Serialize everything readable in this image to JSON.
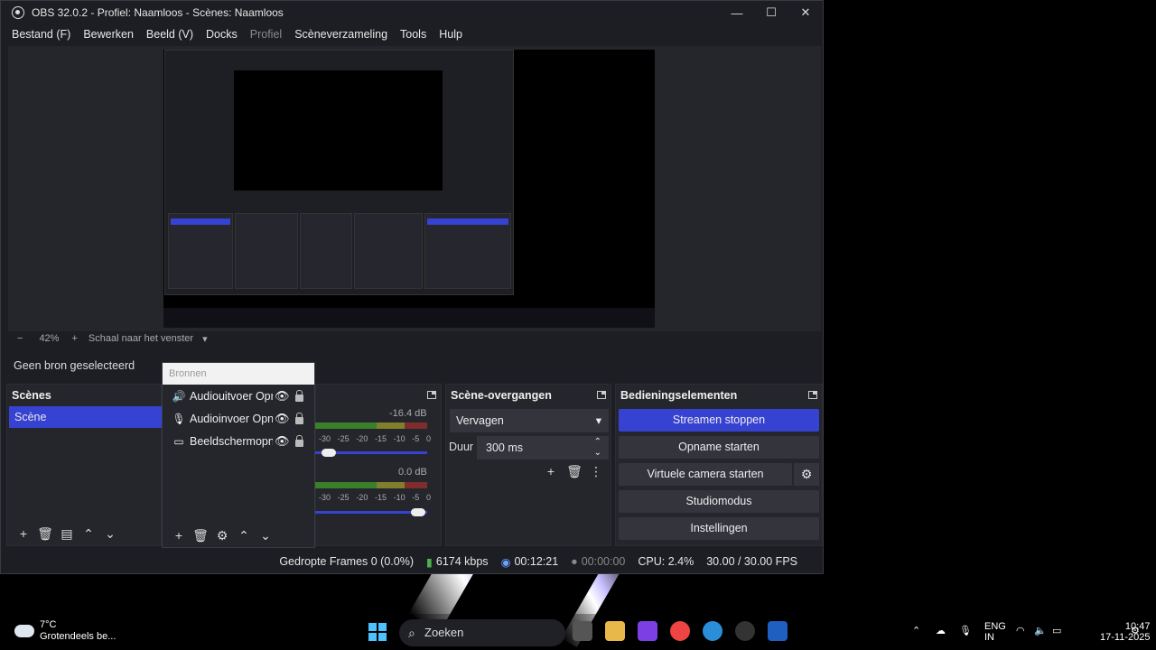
{
  "window": {
    "title": "OBS 32.0.2 - Profiel: Naamloos - Scènes: Naamloos",
    "minimize": "—",
    "maximize": "☐",
    "close": "✕"
  },
  "menu": [
    "Bestand (F)",
    "Bewerken",
    "Beeld (V)",
    "Docks",
    "Profiel",
    "Scèneverzameling",
    "Tools",
    "Hulp"
  ],
  "zoom": {
    "minus": "−",
    "level": "42%",
    "plus": "+",
    "mode": "Schaal naar het venster"
  },
  "source_toolbar": {
    "no_source": "Geen bron geselecteerd"
  },
  "scenes": {
    "title": "Scènes",
    "items": [
      "Scène"
    ]
  },
  "sources": {
    "header": "Bronnen",
    "items": [
      {
        "name": "Audiouitvoer Opname",
        "icon": "speaker-icon"
      },
      {
        "name": "Audioinvoer Opname",
        "icon": "microphone-icon"
      },
      {
        "name": "Beeldschermopname",
        "icon": "monitor-icon"
      }
    ]
  },
  "mixer": {
    "tracks": [
      {
        "db": "-16.4 dB",
        "volume": 0.12
      },
      {
        "db": "0.0 dB",
        "volume": 0.92
      }
    ],
    "scale": [
      "-30",
      "-25",
      "-20",
      "-15",
      "-10",
      "-5",
      "0"
    ]
  },
  "transitions": {
    "title": "Scène-overgangen",
    "type": "Vervagen",
    "duration_label": "Duur",
    "duration": "300 ms"
  },
  "controls": {
    "title": "Bedieningselementen",
    "buttons": [
      "Streamen stoppen",
      "Opname starten",
      "Virtuele camera starten",
      "Studiomodus",
      "Instellingen"
    ]
  },
  "status": {
    "dropped": "Gedropte Frames 0 (0.0%)",
    "bitrate": "6174 kbps",
    "stream_time": "00:12:21",
    "rec_time": "00:00:00",
    "cpu": "CPU: 2.4%",
    "fps": "30.00 / 30.00 FPS"
  },
  "taskbar": {
    "temp": "7°C",
    "weather": "Grotendeels be...",
    "search": "Zoeken",
    "lang1": "ENG",
    "lang2": "IN",
    "time": "10:47",
    "date": "17-11-2025"
  },
  "colors": {
    "accent": "#3642d1",
    "panel": "#25262c",
    "window": "#1d1e24"
  }
}
